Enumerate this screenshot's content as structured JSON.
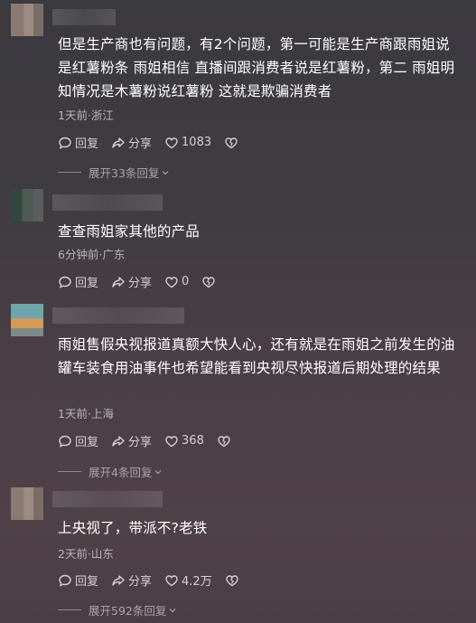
{
  "comments": [
    {
      "text": "但是生产商也有问题，有2个问题，第一可能是生产商跟雨姐说是红薯粉条 雨姐相信 直播间跟消费者说是红薯粉，第二 雨姐明知情况是木薯粉说红薯粉 这就是欺骗消费者",
      "meta": "1天前·浙江",
      "reply": "回复",
      "share": "分享",
      "likes": "1083",
      "expand": "展开33条回复"
    },
    {
      "text": "查查雨姐家其他的产品",
      "meta": "6分钟前·广东",
      "reply": "回复",
      "share": "分享",
      "likes": "0"
    },
    {
      "text": "雨姐售假央视报道真额大快人心，还有就是在雨姐之前发生的油罐车装食用油事件也希望能看到央视尽快报道后期处理的结果",
      "meta": "1天前·上海",
      "reply": "回复",
      "share": "分享",
      "likes": "368",
      "expand": "展开4条回复"
    },
    {
      "text": "上央视了，带派不?老铁",
      "meta": "2天前·山东",
      "reply": "回复",
      "share": "分享",
      "likes": "4.2万",
      "expand": "展开592条回复"
    }
  ]
}
